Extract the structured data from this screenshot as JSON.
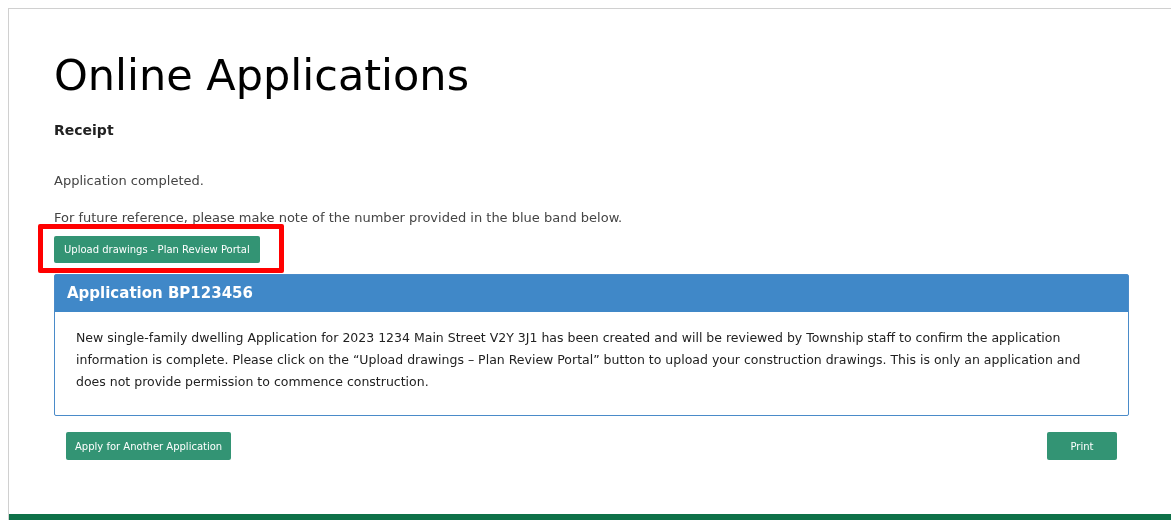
{
  "page_title": "Online Applications",
  "section_heading": "Receipt",
  "messages": [
    "Application completed.",
    "For future reference, please make note of the number provided in the blue band below."
  ],
  "upload_button": {
    "label": "Upload drawings - Plan Review Portal",
    "highlighted": true
  },
  "application_panel": {
    "title": "Application BP123456",
    "body": "New single-family dwelling Application for 2023 1234 Main Street V2Y 3J1 has been created and will be reviewed by Township staff to confirm the application information is complete. Please click on the “Upload drawings – Plan Review Portal” button to upload your construction drawings. This is only an application and does not provide permission to commence construction."
  },
  "actions": [
    {
      "label": "Apply for Another Application"
    },
    {
      "label": "Print"
    }
  ]
}
